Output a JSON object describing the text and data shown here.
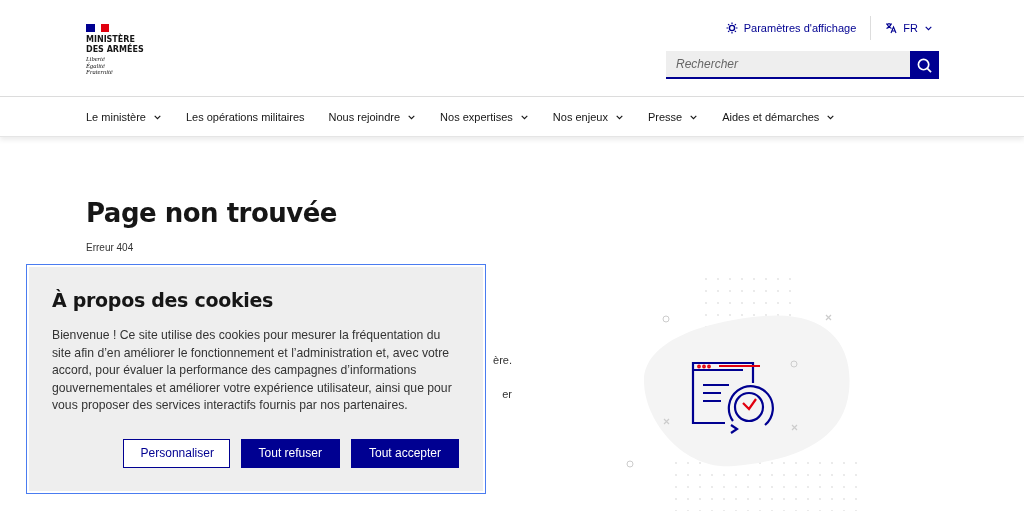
{
  "header": {
    "logo": {
      "lines": [
        "MINISTÈRE",
        "DES ARMÉES"
      ],
      "motto": [
        "Liberté",
        "Égalité",
        "Fraternité"
      ]
    },
    "display_settings": "Paramètres d'affichage",
    "language": "FR",
    "search": {
      "placeholder": "Rechercher"
    }
  },
  "nav": [
    {
      "label": "Le ministère",
      "dropdown": true
    },
    {
      "label": "Les opérations militaires",
      "dropdown": false
    },
    {
      "label": "Nous rejoindre",
      "dropdown": true
    },
    {
      "label": "Nos expertises",
      "dropdown": true
    },
    {
      "label": "Nos enjeux",
      "dropdown": true
    },
    {
      "label": "Presse",
      "dropdown": true
    },
    {
      "label": "Aides et démarches",
      "dropdown": true
    }
  ],
  "page": {
    "title": "Page non trouvée",
    "error": "Erreur 404",
    "partial_lines": [
      "ère.",
      "er"
    ]
  },
  "cookie_dialog": {
    "title": "À propos des cookies",
    "text": "Bienvenue ! Ce site utilise des cookies pour mesurer la fréquentation du site afin d’en améliorer le fonctionnement et l’administration et, avec votre accord, pour évaluer la performance des campagnes d’informations gouvernementales et améliorer votre expérience utilisateur, ainsi que pour vous proposer des services interactifs fournis par nos partenaires.",
    "buttons": [
      {
        "label": "Personnaliser",
        "kind": "secondary"
      },
      {
        "label": "Tout refuser",
        "kind": "primary"
      },
      {
        "label": "Tout accepter",
        "kind": "primary"
      }
    ]
  }
}
